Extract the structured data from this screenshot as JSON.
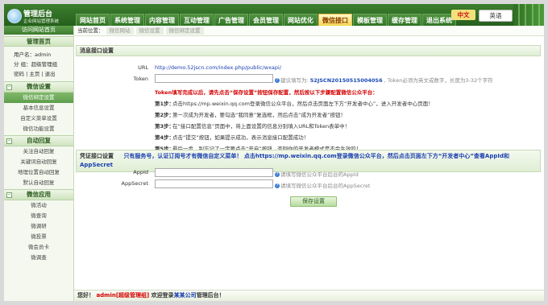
{
  "app": {
    "logo_title": "管理后台",
    "logo_subtitle": "企业网站管理系统"
  },
  "nav": {
    "tabs": [
      "网站首页",
      "系统管理",
      "内容管理",
      "互动管理",
      "广告管理",
      "会员管理",
      "网站优化",
      "微信接口",
      "模板管理",
      "缓存管理",
      "退出系统"
    ],
    "active": "微信接口"
  },
  "lang": {
    "cn": "中文",
    "en": "英语"
  },
  "sidebar": {
    "banner": "访问网站首页",
    "admin_title": "管理首页",
    "user_label": "用户名：",
    "user_value": "admin",
    "group_label": "分   组：",
    "group_value": "超级管理组",
    "links": [
      "密码",
      "主页",
      "退出"
    ],
    "sections": [
      {
        "title": "微信设置",
        "items": [
          "微信绑定设置",
          "基本信息设置",
          "自定义菜单设置",
          "微信功能设置"
        ],
        "active": "微信绑定设置"
      },
      {
        "title": "自动回复",
        "items": [
          "关注自动回复",
          "关键词自动回复",
          "地理位置自动回复",
          "默认自动回复"
        ]
      },
      {
        "title": "微信应用",
        "items": [
          "微活动",
          "微查询",
          "微调研",
          "微投票",
          "微会员卡",
          "微调查"
        ]
      }
    ]
  },
  "crumb": {
    "label": "当前位置：",
    "items": [
      "微信网站",
      "微信设置",
      "微信绑定设置"
    ]
  },
  "interface": {
    "title": "消息接口设置",
    "url_label": "URL",
    "url_value": "http://demo.52jscn.com/index.php/public/wxapi/",
    "token_label": "Token",
    "token_hint_prefix": "建议填写为:",
    "token_hint_value": "52JSCN201505150040S6",
    "token_hint_suffix": "Token必须为英文或数字，长度为3-32个字符",
    "warn": "Token填写完成以后，请先点击“保存设置”按钮保存配置，然后按以下步骤配置微信公众平台：",
    "steps": [
      {
        "n": "第1步：",
        "t": "点击https://mp.weixin.qq.com登录微信公众平台，然后点击页面左下方“开发者中心”，进入开发者中心页面！"
      },
      {
        "n": "第2步：",
        "t": "第一次成为开发者，要勾选“我同意”复选框，然后点击“成为开发者”按钮！"
      },
      {
        "n": "第3步：",
        "t": "在“接口配置信息”页面中，将上面设置的信息分别填入URL和Token表单中！"
      },
      {
        "n": "第4步：",
        "t": "点击“提交”按钮，如果提示成功，表示消息接口配置成功！"
      },
      {
        "n": "第5步：",
        "t": "最后一步，别忘记了一定要点击“开启”按钮，否则你的开发者模式是不会生效的！"
      }
    ]
  },
  "credential": {
    "title": "凭证接口设置",
    "notice": "只有服务号，认证订阅号才有微信自定义菜单！ 点击https://mp.weixin.qq.com登录微信公众平台，然后点击页面左下方“开发者中心”查看AppId和AppSecret",
    "appid_label": "AppId",
    "appid_hint": "请填写微信公众平台后台的AppId",
    "secret_label": "AppSecret",
    "secret_hint": "请填写微信公众平台后台的AppSecret",
    "save": "保存设置"
  },
  "footer": {
    "p1": "您好！",
    "user": "admin[超级管理组]",
    "p2": "欢迎登录",
    "site": "某某公司",
    "p3": "管理后台！"
  },
  "colors": {
    "header": "#2f7424",
    "accent": "#f2d24a",
    "warn": "#d40000",
    "link": "#1a3fb0"
  }
}
